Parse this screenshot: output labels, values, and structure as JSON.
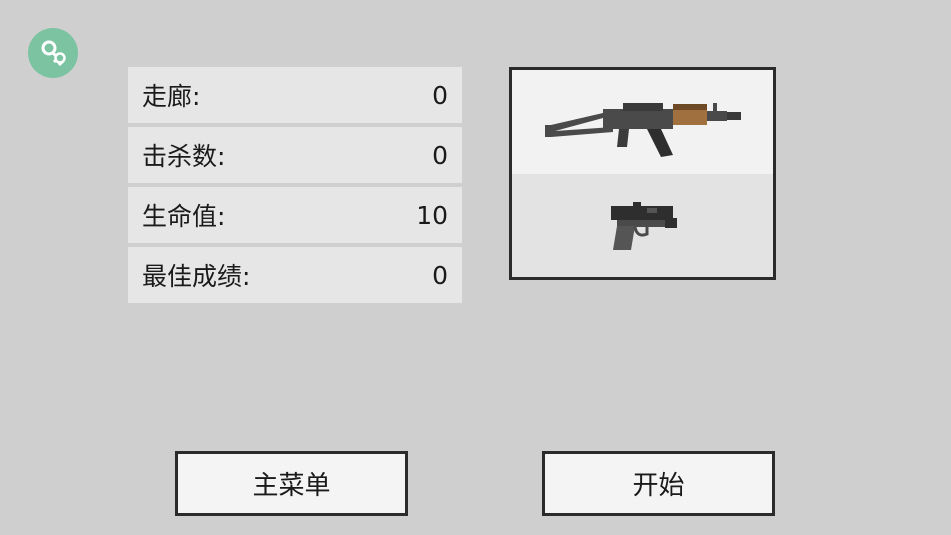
{
  "icons": {
    "key_button": "key-icon",
    "primary_weapon": "rifle-icon",
    "secondary_weapon": "pistol-icon"
  },
  "colors": {
    "background": "#cfcfcf",
    "stat_row": "#e6e6e6",
    "key_button": "#7cc3a2",
    "border": "#2b2b2b"
  },
  "stats": [
    {
      "label": "走廊:",
      "value": "0"
    },
    {
      "label": "击杀数:",
      "value": "0"
    },
    {
      "label": "生命值:",
      "value": "10"
    },
    {
      "label": "最佳成绩:",
      "value": "0"
    }
  ],
  "buttons": {
    "main_menu": "主菜单",
    "start": "开始"
  }
}
